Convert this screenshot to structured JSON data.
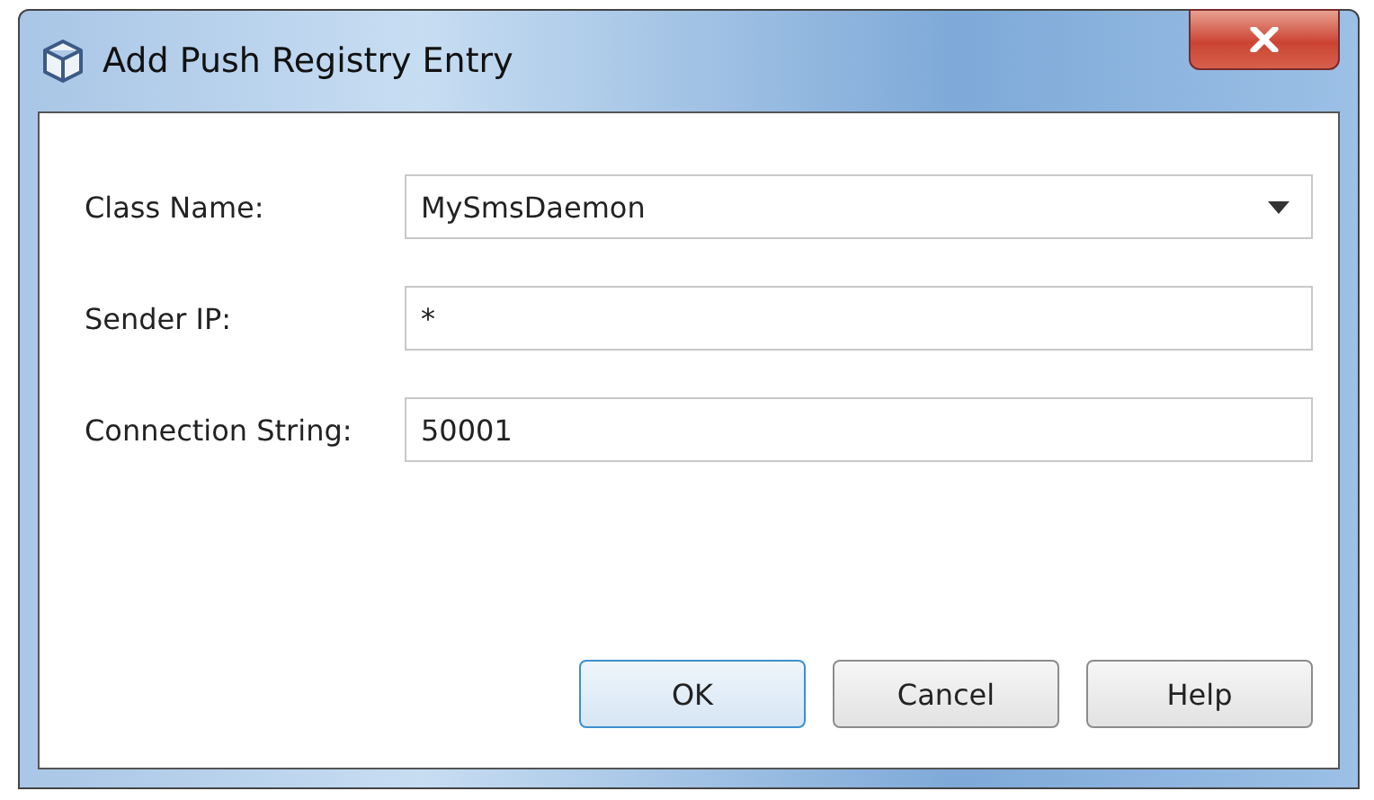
{
  "window": {
    "title": "Add Push Registry Entry"
  },
  "fields": [
    {
      "label": "Class Name:",
      "kind": "dropdown",
      "value": "MySmsDaemon"
    },
    {
      "label": "Sender IP:",
      "kind": "text",
      "value": "*"
    },
    {
      "label": "Connection String:",
      "kind": "text",
      "value": "50001"
    }
  ],
  "buttons": [
    {
      "label": "OK",
      "default": true
    },
    {
      "label": "Cancel",
      "default": false
    },
    {
      "label": "Help",
      "default": false
    }
  ]
}
